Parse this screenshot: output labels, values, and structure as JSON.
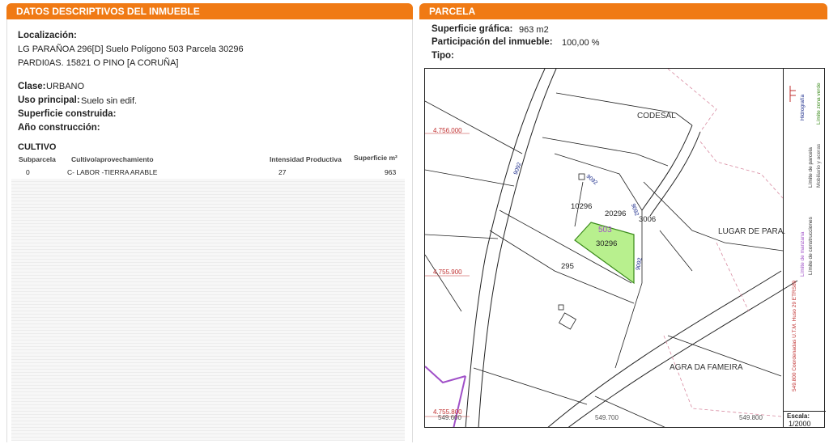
{
  "left_panel": {
    "title": "DATOS DESCRIPTIVOS DEL INMUEBLE",
    "localizacion_label": "Localización:",
    "address_line1": "LG PARAÑOA 296[D] Suelo Polígono 503 Parcela 30296",
    "address_line2": "PARDI0AS. 15821 O PINO [A CORUÑA]",
    "clase_label": "Clase:",
    "clase_value": "URBANO",
    "uso_label": "Uso principal:",
    "uso_value": "Suelo sin edif.",
    "superficie_label": "Superficie construida:",
    "ano_label": "Año construcción:",
    "cultivo_title": "CULTIVO",
    "table": {
      "headers": [
        "Subparcela",
        "Cultivo/aprovechamiento",
        "Intensidad Productiva",
        "Superficie m²"
      ],
      "rows": [
        [
          "0",
          "C- LABOR -TIERRA ARABLE",
          "27",
          "963"
        ]
      ]
    }
  },
  "right_panel": {
    "title": "PARCELA",
    "sup_grafica_label": "Superficie gráfica:",
    "sup_grafica_value": "963 m2",
    "participacion_label": "Participación del inmueble:",
    "participacion_value": "100,00 %",
    "tipo_label": "Tipo:"
  },
  "map": {
    "labels": {
      "codesal": "CODESAL",
      "lugar": "LUGAR DE PARA.",
      "agra": "AGRA DA FAMEIRA",
      "p10296": "10296",
      "p20296": "20296",
      "p3006": "3006",
      "poly503": "503",
      "p30296": "30296",
      "p295": "295",
      "road_a": "9092",
      "road_b": "9092",
      "road_c": "9092",
      "road_d": "9092"
    },
    "coords": {
      "y1": "4.756.000",
      "y2": "4.755.900",
      "y3": "4.755.800",
      "x1": "549.600",
      "x2": "549.700",
      "x3": "549.800"
    },
    "legend": {
      "col1a": "Límite de manzana",
      "col1b": "Hidrografía",
      "col2a": "Límite de parcela",
      "col2b": "Límite de construcciones",
      "col3a": "Mobiliario y aceras",
      "col3b": "Límite zona verde",
      "coords_note": "549.800 Coordenadas U.T.M. Huso 29 ETRS89",
      "escala_label": "Escala:",
      "escala_value": "1/2000"
    },
    "colors": {
      "highlight_fill": "#b8f08e",
      "highlight_stroke": "#3a8a1a",
      "grid_red": "#c03030",
      "road_blue": "#1a2a8a",
      "purple": "#a050c8"
    }
  }
}
